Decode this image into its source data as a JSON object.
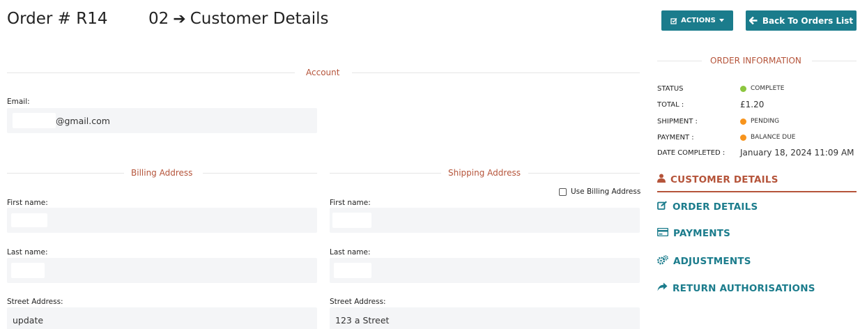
{
  "header": {
    "order_title": "Order # R14",
    "step_number": "02",
    "step_title": "Customer Details",
    "actions_label": "ACTIONS",
    "back_label": "Back To Orders List"
  },
  "account": {
    "section_title": "Account",
    "email_label": "Email:",
    "email_value": "@gmail.com"
  },
  "billing": {
    "section_title": "Billing Address",
    "first_name_label": "First name:",
    "last_name_label": "Last name:",
    "street_label": "Street Address:",
    "street_value": "update"
  },
  "shipping": {
    "section_title": "Shipping Address",
    "use_billing_label": "Use Billing Address",
    "first_name_label": "First name:",
    "last_name_label": "Last name:",
    "street_label": "Street Address:",
    "street_value": "123 a Street"
  },
  "order_info": {
    "section_title": "ORDER INFORMATION",
    "status_label": "STATUS",
    "status_value": "COMPLETE",
    "total_label": "TOTAL :",
    "total_value": "£1.20",
    "shipment_label": "SHIPMENT :",
    "shipment_value": "PENDING",
    "payment_label": "PAYMENT :",
    "payment_value": "BALANCE DUE",
    "date_label": "DATE COMPLETED :",
    "date_value": "January 18, 2024 11:09 AM"
  },
  "side_nav": {
    "customer_details": "CUSTOMER DETAILS",
    "order_details": "ORDER DETAILS",
    "payments": "PAYMENTS",
    "adjustments": "ADJUSTMENTS",
    "return_authorisations": "RETURN AUTHORISATIONS"
  },
  "colors": {
    "accent": "#1b7c8c",
    "section_heading": "#b5543a",
    "status_complete": "#8cc63f",
    "status_pending": "#f7941d",
    "field_background": "#f4f5f7"
  }
}
